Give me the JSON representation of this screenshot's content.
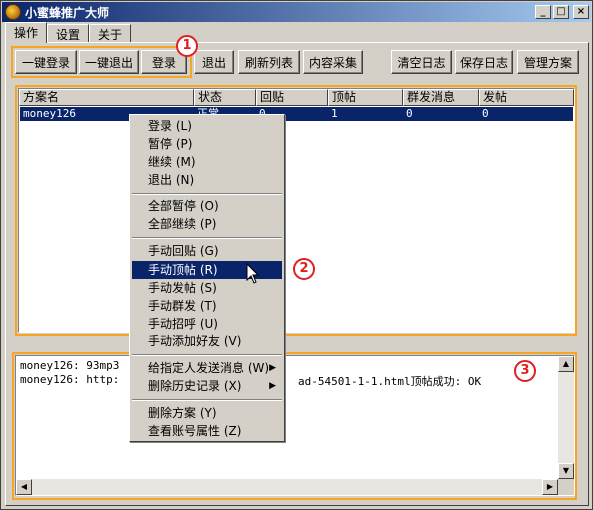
{
  "window": {
    "title": "小蜜蜂推广大师",
    "minimize": "_",
    "maximize": "□",
    "close": "×"
  },
  "tabs": [
    "操作",
    "设置",
    "关于"
  ],
  "toolbar": {
    "login_all": "一键登录",
    "logout_all": "一键退出",
    "login": "登录",
    "logout": "退出",
    "refresh": "刷新列表",
    "collect": "内容采集",
    "clear_log": "清空日志",
    "save_log": "保存日志",
    "manage": "管理方案"
  },
  "markers": [
    "1",
    "2",
    "3"
  ],
  "table": {
    "columns": [
      "方案名",
      "状态",
      "回贴",
      "顶帖",
      "群发消息",
      "发帖"
    ],
    "rows": [
      [
        "money126",
        "正常",
        "0",
        "1",
        "0",
        "0"
      ]
    ]
  },
  "context_menu": {
    "items": [
      {
        "label": "登录",
        "key": "(L)"
      },
      {
        "label": "暂停",
        "key": "(P)"
      },
      {
        "label": "继续",
        "key": "(M)"
      },
      {
        "label": "退出",
        "key": "(N)"
      },
      {
        "label": "全部暂停",
        "key": "(O)"
      },
      {
        "label": "全部继续",
        "key": "(P)"
      },
      {
        "label": "手动回贴",
        "key": "(G)"
      },
      {
        "label": "手动顶帖",
        "key": "(R)"
      },
      {
        "label": "手动发帖",
        "key": "(S)"
      },
      {
        "label": "手动群发",
        "key": "(T)"
      },
      {
        "label": "手动招呼",
        "key": "(U)"
      },
      {
        "label": "手动添加好友",
        "key": "(V)"
      },
      {
        "label": "给指定人发送消息",
        "key": "(W)"
      },
      {
        "label": "删除历史记录",
        "key": "(X)"
      },
      {
        "label": "删除方案",
        "key": "(Y)"
      },
      {
        "label": "查看账号属性",
        "key": "(Z)"
      }
    ]
  },
  "log": {
    "lines": [
      "money126: 93mp3",
      "money126: http:"
    ],
    "tail": "ad-54501-1-1.html顶帖成功: OK"
  }
}
